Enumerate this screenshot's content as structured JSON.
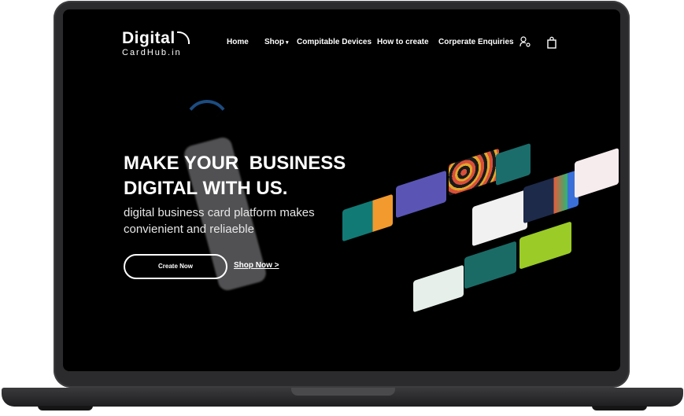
{
  "logo": {
    "top": "Digital",
    "bottom": "CardHub.in"
  },
  "nav": {
    "home": "Home",
    "shop": "Shop",
    "devices": "Compitable Devices",
    "howto": "How to create",
    "corporate": "Corperate Enquiries"
  },
  "icons": {
    "account": "user-key-icon",
    "cart": "shopping-bag-icon",
    "shop_dropdown": "chevron-down-icon"
  },
  "hero": {
    "line1": "MAKE YOUR  BUSINESS",
    "line2": "DIGITAL WITH US.",
    "sub": "digital business card platform makes convienient and reliaeble",
    "create_label": "Create Now",
    "shop_label": "Shop Now >"
  },
  "colors": {
    "screen_bg": "#000000",
    "text": "#ffffff",
    "frame": "#2b2b2d"
  }
}
